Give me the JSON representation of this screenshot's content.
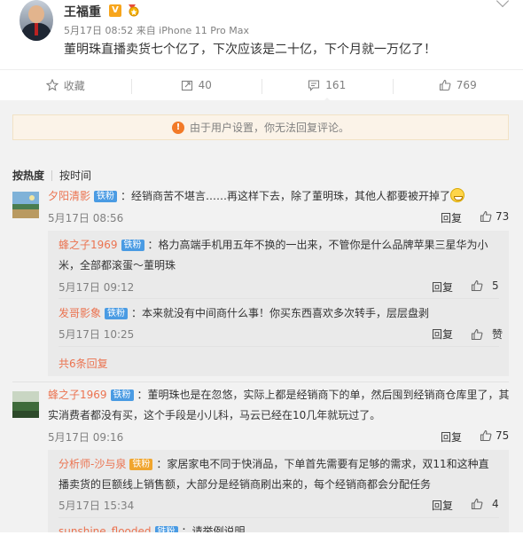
{
  "post": {
    "author": "王福重",
    "verified_badge": "V",
    "meta": "5月17日 08:52 来自 iPhone 11 Pro Max",
    "text": "董明珠直播卖货七个亿了，下次应该是二十亿，下个月就一万亿了！"
  },
  "actions": {
    "favorite": "收藏",
    "repost": "40",
    "comment": "161",
    "like": "769"
  },
  "notice": "由于用户设置，你无法回复评论。",
  "sort": {
    "hot": "按热度",
    "time": "按时间"
  },
  "comments": [
    {
      "user": "夕阳清影",
      "badge": "铁粉",
      "text_line1": "：经销商苦不堪言……再这样下去，除了董明珠，其他人都要被开掉了",
      "time": "5月17日 08:56",
      "reply": "回复",
      "likes": "73",
      "subs": [
        {
          "user": "蜂之子1969",
          "badge": "铁粉",
          "text_line1": "：格力高端手机用五年不换的一出来，不管你是什么品牌苹果三星华为小",
          "text_line2": "米，全部都滚蛋～董明珠",
          "time": "5月17日 09:12",
          "reply": "回复",
          "likes": "5"
        },
        {
          "user": "发哥影象",
          "badge": "铁粉",
          "text_line1": "：本来就没有中间商什么事！你买东西喜欢多次转手，层层盘剥",
          "time": "5月17日 10:25",
          "reply": "回复",
          "likes": "赞"
        }
      ],
      "more": "共6条回复"
    },
    {
      "user": "蜂之子1969",
      "badge": "铁粉",
      "text_line1": "：董明珠也是在忽悠，实际上都是经销商下的单，然后囤到经销商仓库里了，其",
      "text_line2": "实消费者都没有买，这个手段是小儿科，马云已经在10几年就玩过了。",
      "time": "5月17日 09:16",
      "reply": "回复",
      "likes": "75",
      "subs": [
        {
          "user": "分析师-沙与泉",
          "badge": "铁粉",
          "text_line1": "：家居家电不同于快消品，下单首先需要有足够的需求，双11和这种直",
          "text_line2": "播卖货的巨额线上销售额，大部分是经销商刷出来的，每个经销商都会分配任务",
          "time": "5月17日 15:34",
          "reply": "回复",
          "likes": "4"
        },
        {
          "user": "sunshine_flooded",
          "badge": "铁粉",
          "text_line1": "：请举例说明"
        }
      ]
    }
  ]
}
